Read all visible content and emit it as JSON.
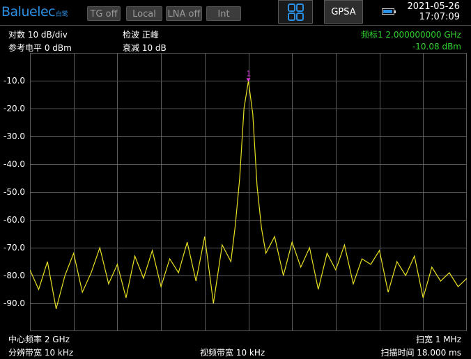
{
  "topbar": {
    "logo_text": "Baluelec",
    "logo_sub": "白鹭",
    "buttons": [
      "TG off",
      "Local",
      "LNA off",
      "Int"
    ],
    "mode_label": "GPSA",
    "date": "2021-05-26",
    "time": "17:07:09",
    "icons": {
      "layout": "grid-4-icon",
      "battery": "battery-icon"
    }
  },
  "header": {
    "scale": "对数 10 dB/div",
    "ref_level": "参考电平 0 dBm",
    "detector": "检波 正峰",
    "attenuation": "衰减 10 dB",
    "marker_freq": "频标1  2.000000000 GHz",
    "marker_level": "-10.08 dBm"
  },
  "footer": {
    "center_freq": "中心频率 2 GHz",
    "span": "扫宽 1 MHz",
    "rbw": "分辨带宽 10 kHz",
    "vbw": "视频带宽 10 kHz",
    "sweep_time": "扫描时间 18.000 ms"
  },
  "colors": {
    "trace": "#e8e020",
    "marker": "#e040e0",
    "marker_text": "#2fd12f",
    "grid": "#5a5a5a",
    "accent": "#2a8fe0"
  },
  "chart_data": {
    "type": "line",
    "y_tick_labels": [
      "-10.0",
      "-20.0",
      "-30.0",
      "-40.0",
      "-50.0",
      "-60.0",
      "-70.0",
      "-80.0",
      "-90.0"
    ],
    "ylim": [
      -100,
      0
    ],
    "xlim": [
      1999.5,
      2000.5
    ],
    "grid": true,
    "marker": {
      "label": "1",
      "x": 2000.0,
      "y": -10.08
    },
    "series": [
      {
        "x": [
          1999.5,
          1999.52,
          1999.54,
          1999.56,
          1999.58,
          1999.6,
          1999.62,
          1999.64,
          1999.66,
          1999.68,
          1999.7,
          1999.72,
          1999.74,
          1999.76,
          1999.78,
          1999.8,
          1999.82,
          1999.84,
          1999.86,
          1999.88,
          1999.9,
          1999.92,
          1999.94,
          1999.96,
          1999.97,
          1999.98,
          1999.99,
          2000.0,
          2000.01,
          2000.02,
          2000.03,
          2000.04,
          2000.06,
          2000.08,
          2000.1,
          2000.12,
          2000.14,
          2000.16,
          2000.18,
          2000.2,
          2000.22,
          2000.24,
          2000.26,
          2000.28,
          2000.3,
          2000.32,
          2000.34,
          2000.36,
          2000.38,
          2000.4,
          2000.42,
          2000.44,
          2000.46,
          2000.48,
          2000.5
        ],
        "y": [
          -78,
          -85,
          -75,
          -92,
          -80,
          -72,
          -86,
          -79,
          -70,
          -83,
          -76,
          -88,
          -73,
          -81,
          -71,
          -84,
          -74,
          -79,
          -68,
          -82,
          -66,
          -90,
          -69,
          -75,
          -62,
          -45,
          -20,
          -10.08,
          -22,
          -48,
          -63,
          -72,
          -66,
          -80,
          -68,
          -77,
          -70,
          -85,
          -72,
          -78,
          -69,
          -83,
          -74,
          -76,
          -71,
          -86,
          -75,
          -80,
          -73,
          -88,
          -77,
          -82,
          -79,
          -84,
          -81
        ]
      }
    ]
  }
}
